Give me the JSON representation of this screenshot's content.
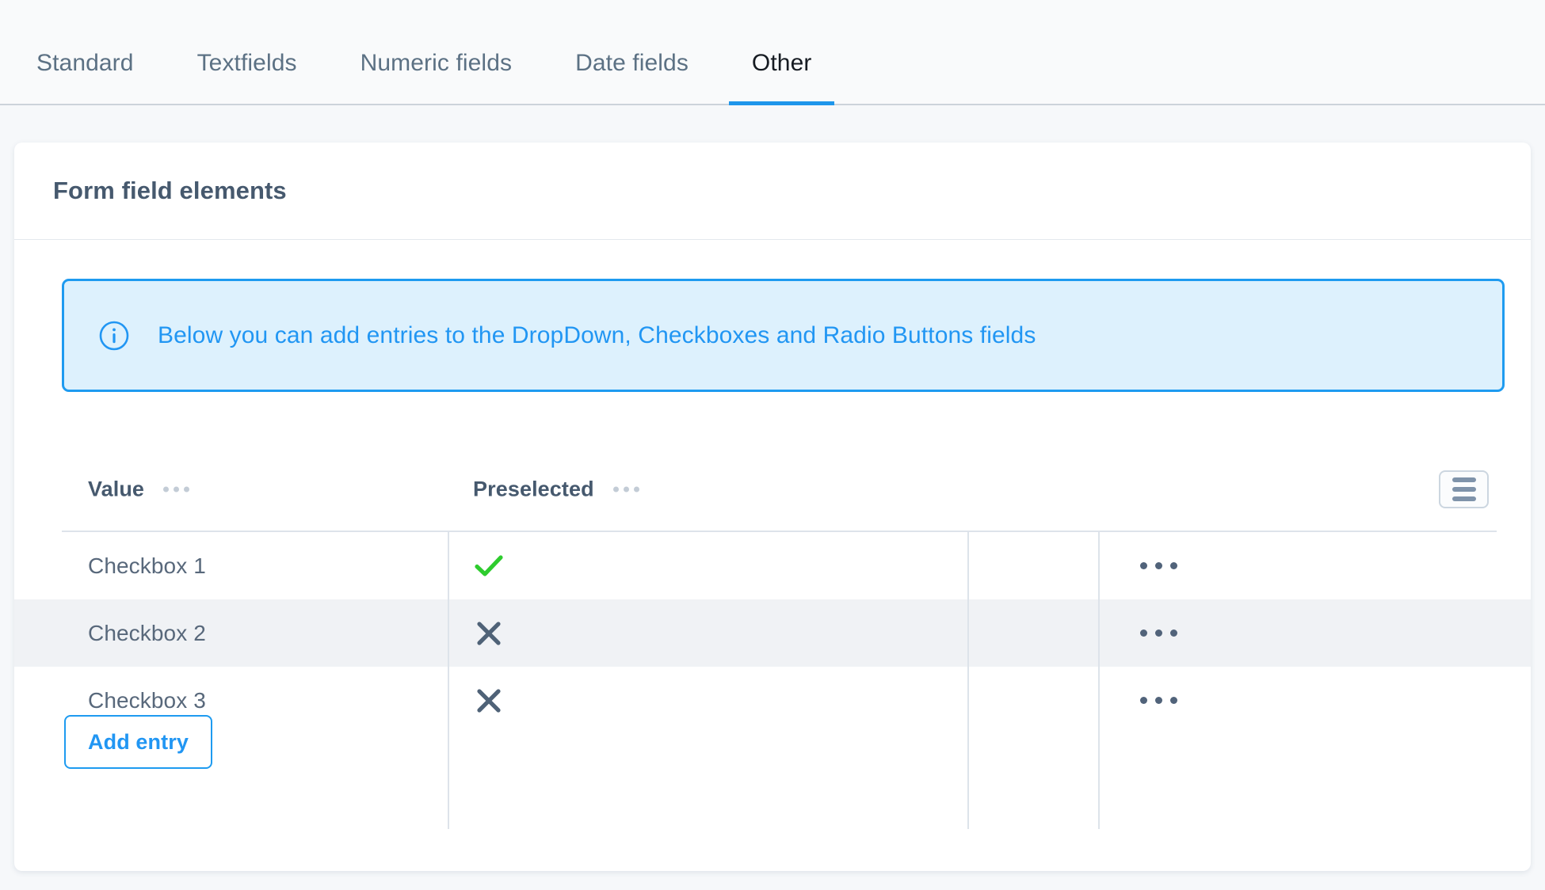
{
  "tabs": [
    {
      "label": "Standard",
      "active": false
    },
    {
      "label": "Textfields",
      "active": false
    },
    {
      "label": "Numeric fields",
      "active": false
    },
    {
      "label": "Date fields",
      "active": false
    },
    {
      "label": "Other",
      "active": true
    }
  ],
  "card": {
    "title": "Form field elements"
  },
  "banner": {
    "icon": "info-circle-icon",
    "text": "Below you can add entries to the DropDown, Checkboxes and Radio Buttons fields",
    "accent_color": "#1e9bf0",
    "background_color": "#ddf1fd",
    "text_color": "#2196f3"
  },
  "table": {
    "columns": [
      {
        "label": "Value",
        "menu_icon": "ellipsis-icon"
      },
      {
        "label": "Preselected",
        "menu_icon": "ellipsis-icon"
      }
    ],
    "grid_menu_icon": "hamburger-icon",
    "rows": [
      {
        "value": "Checkbox 1",
        "preselected": true,
        "preselected_icon": "check-icon",
        "actions_icon": "ellipsis-icon"
      },
      {
        "value": "Checkbox 2",
        "preselected": false,
        "preselected_icon": "cross-icon",
        "actions_icon": "ellipsis-icon"
      },
      {
        "value": "Checkbox 3",
        "preselected": false,
        "preselected_icon": "cross-icon",
        "actions_icon": "ellipsis-icon"
      }
    ],
    "check_color": "#2ecc2e",
    "cross_color": "#4f6277"
  },
  "actions": {
    "add_entry_label": "Add entry"
  }
}
